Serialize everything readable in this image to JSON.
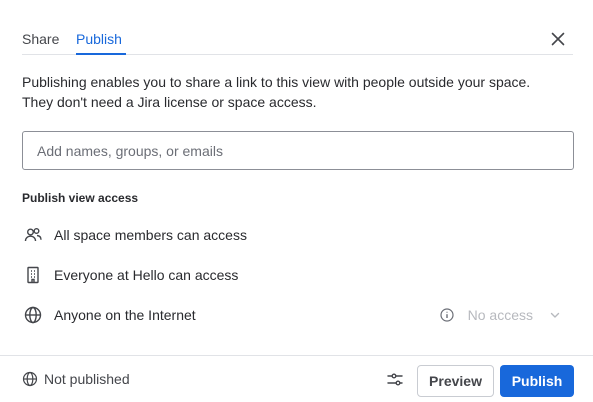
{
  "tabs": {
    "share": "Share",
    "publish": "Publish",
    "active": "Publish"
  },
  "description": {
    "line1": "Publishing enables you to share a link to this view with people outside your space.",
    "line2": "They don't need a Jira license or space access."
  },
  "search": {
    "placeholder": "Add names, groups, or emails",
    "value": ""
  },
  "access": {
    "title": "Publish view access",
    "rows": [
      {
        "icon": "people-icon",
        "label": "All space members can access"
      },
      {
        "icon": "building-icon",
        "label": "Everyone at Hello can access"
      },
      {
        "icon": "globe-icon",
        "label": "Anyone on the Internet",
        "value": "No access",
        "info_icon": "info-icon",
        "dropdown_icon": "chevron-down-icon"
      }
    ]
  },
  "footer": {
    "status": "Not published",
    "status_icon": "globe-icon",
    "settings_icon": "settings-sliders-icon",
    "preview_label": "Preview",
    "publish_label": "Publish"
  },
  "colors": {
    "accent": "#1868db",
    "text": "#292a2e",
    "muted": "#6b6e76",
    "disabled": "#b7b9be",
    "border": "#e1e3e7"
  }
}
